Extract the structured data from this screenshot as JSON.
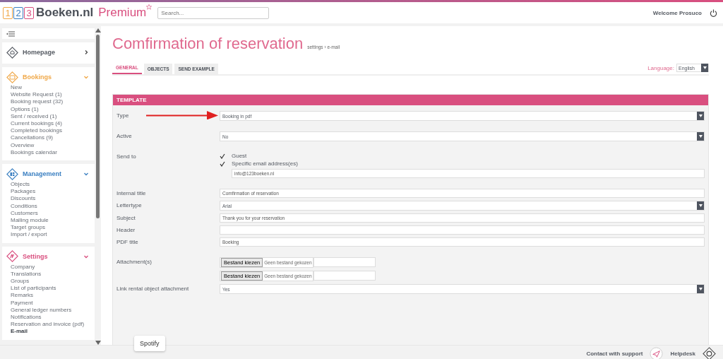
{
  "header": {
    "logo_digits": [
      "1",
      "2",
      "3"
    ],
    "logo_name": "Boeken.nl",
    "logo_tier": "Premium",
    "search": {
      "placeholder": "Search..."
    },
    "welcome": "Welcome Prosuco"
  },
  "sidebar": {
    "sections": [
      {
        "title": "Homepage",
        "color": "#555a62",
        "expanded": false
      },
      {
        "title": "Bookings",
        "color": "#f0a848",
        "expanded": true,
        "items": [
          {
            "label": "New",
            "selected": false
          },
          {
            "label": "Website Request (1)",
            "selected": false
          },
          {
            "label": "Booking request (32)",
            "selected": false
          },
          {
            "label": "Options (1)",
            "selected": false
          },
          {
            "label": "Sent / received (1)",
            "selected": false
          },
          {
            "label": "Current bookings (4)",
            "selected": false
          },
          {
            "label": "Completed bookings",
            "selected": false
          },
          {
            "label": "Cancellations (9)",
            "selected": false
          },
          {
            "label": "Overview",
            "selected": false
          },
          {
            "label": "Bookings calendar",
            "selected": false
          }
        ]
      },
      {
        "title": "Management",
        "color": "#3a7fc1",
        "expanded": true,
        "items": [
          {
            "label": "Objects",
            "selected": false
          },
          {
            "label": "Packages",
            "selected": false
          },
          {
            "label": "Discounts",
            "selected": false
          },
          {
            "label": "Conditions",
            "selected": false
          },
          {
            "label": "Customers",
            "selected": false
          },
          {
            "label": "Mailing module",
            "selected": false
          },
          {
            "label": "Target groups",
            "selected": false
          },
          {
            "label": "Import / export",
            "selected": false
          }
        ]
      },
      {
        "title": "Settings",
        "color": "#d94f7f",
        "expanded": true,
        "items": [
          {
            "label": "Company",
            "selected": false
          },
          {
            "label": "Translations",
            "selected": false
          },
          {
            "label": "Groups",
            "selected": false
          },
          {
            "label": "List of participants",
            "selected": false
          },
          {
            "label": "Remarks",
            "selected": false
          },
          {
            "label": "Payment",
            "selected": false
          },
          {
            "label": "General ledger numbers",
            "selected": false
          },
          {
            "label": "Notifications",
            "selected": false
          },
          {
            "label": "Reservation and invoice (pdf)",
            "selected": false
          },
          {
            "label": "E-mail",
            "selected": true
          }
        ]
      }
    ]
  },
  "page": {
    "title": "Comfirmation of reservation",
    "breadcrumb": "settings › e-mail",
    "tabs": [
      {
        "label": "GENERAL",
        "selected": true
      },
      {
        "label": "OBJECTS",
        "selected": false
      },
      {
        "label": "SEND EXAMPLE",
        "selected": false
      }
    ],
    "language": {
      "label": "Language:",
      "value": "English"
    },
    "panel_title": "TEMPLATE",
    "groups": [
      [
        {
          "kind": "select",
          "label": "Type",
          "value": "Booking in pdf",
          "arrow": true
        }
      ],
      [
        {
          "kind": "select",
          "label": "Active",
          "value": "No"
        }
      ],
      [
        {
          "kind": "checks",
          "label": "Send to",
          "options": [
            {
              "label": "Guest",
              "checked": true
            },
            {
              "label": "Specific email address(es)",
              "checked": true
            }
          ],
          "value": "info@123boeken.nl"
        }
      ],
      [
        {
          "kind": "text",
          "label": "Internal title",
          "value": "Comfirmation of reservation"
        },
        {
          "kind": "select",
          "label": "Lettertype",
          "value": "Arial"
        },
        {
          "kind": "text",
          "label": "Subject",
          "value": "Thank you for your reservation"
        },
        {
          "kind": "text",
          "label": "Header"
        },
        {
          "kind": "text",
          "label": "PDF title",
          "value": "Boeking"
        }
      ],
      [
        {
          "kind": "file",
          "label": "Attachment(s)",
          "files": [
            {
              "button": "Bestand kiezen",
              "status": "Geen bestand gekozen"
            },
            {
              "button": "Bestand kiezen",
              "status": "Geen bestand gekozen"
            }
          ]
        },
        {
          "kind": "select",
          "label": "Link rental object attachment",
          "value": "Yes"
        }
      ]
    ]
  },
  "footer": {
    "tooltip": "Spotify",
    "support": "Contact with support",
    "helpdesk": "Helpdesk"
  }
}
